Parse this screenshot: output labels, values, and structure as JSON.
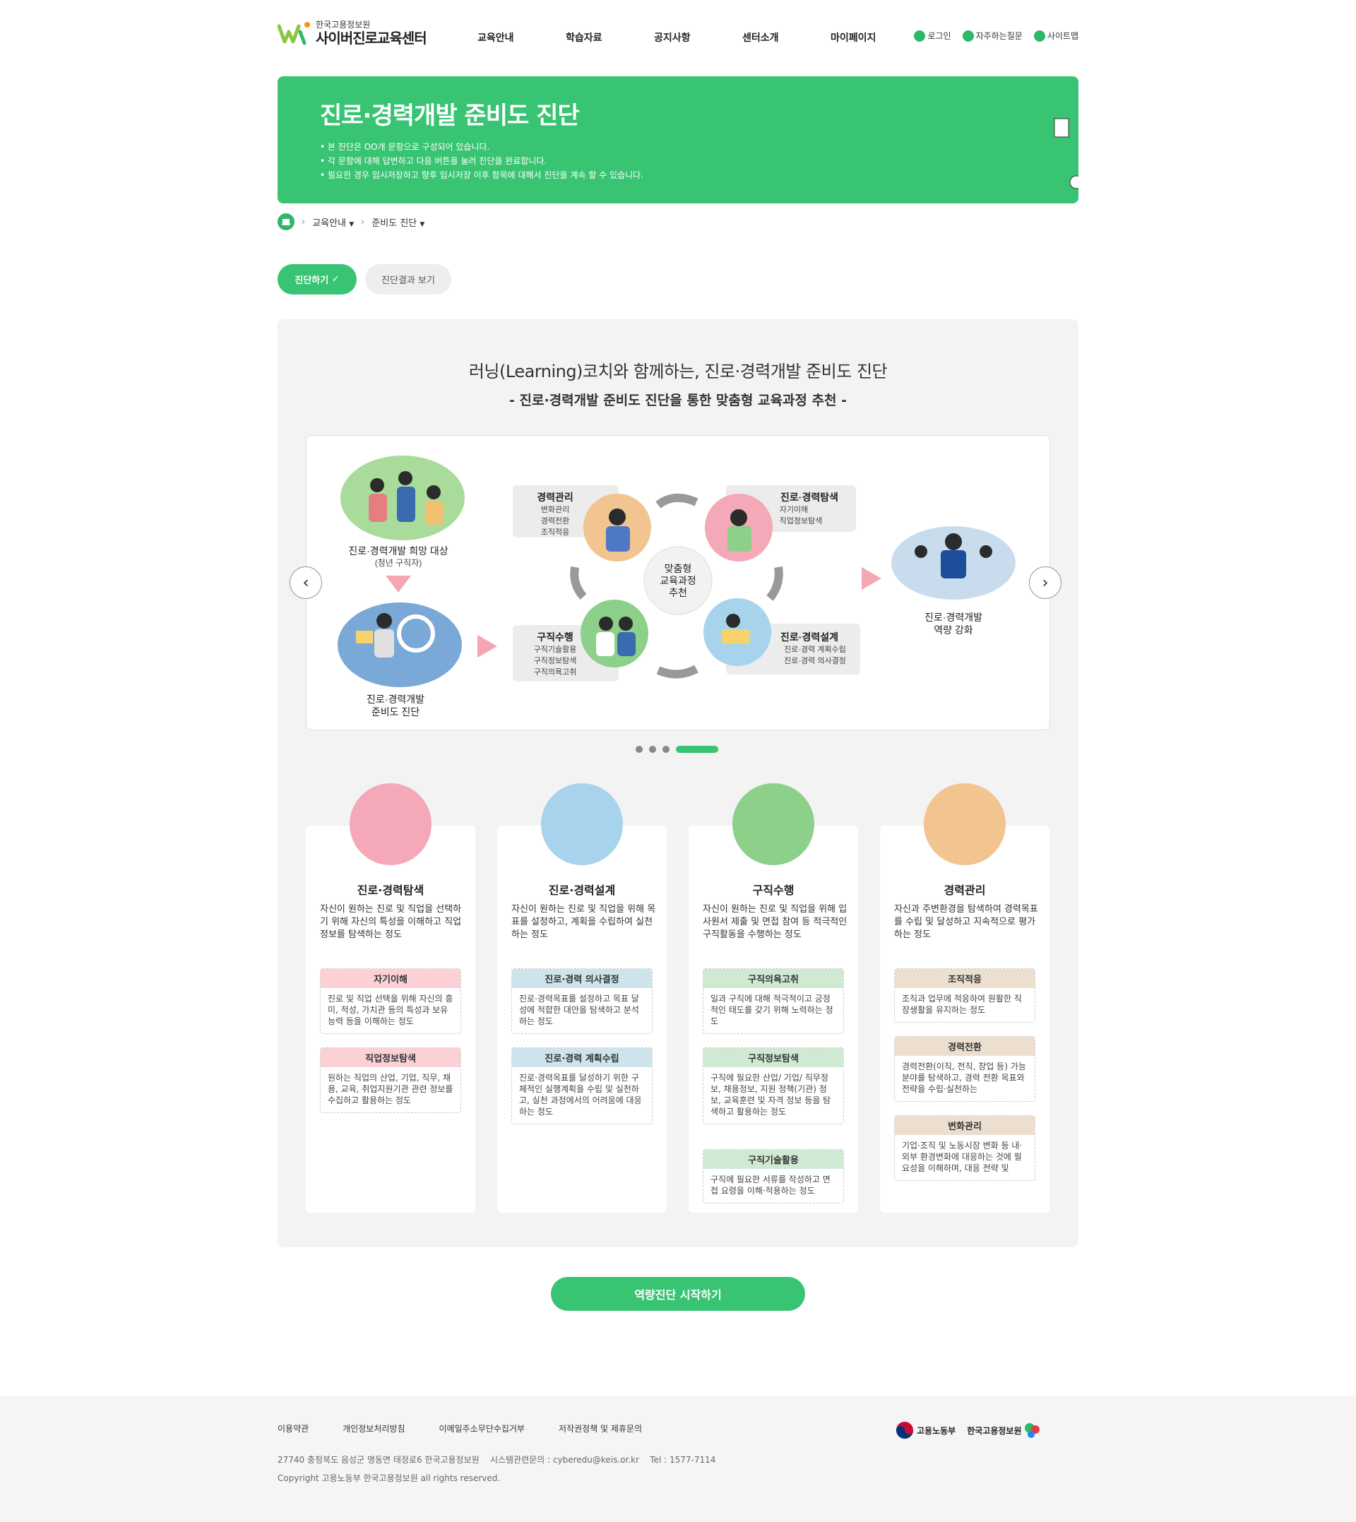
{
  "header": {
    "org": "한국고용정보원",
    "site_title": "사이버진로교육센터",
    "nav": [
      "교육안내",
      "학습자료",
      "공지사항",
      "센터소개",
      "마이페이지"
    ],
    "util": [
      "로그인",
      "자주하는질문",
      "사이트맵"
    ]
  },
  "banner": {
    "title": "진로·경력개발 준비도 진단",
    "bullets": [
      "• 본 진단은 OO개 문항으로 구성되어 있습니다.",
      "• 각 문항에 대해 답변하고 다음 버튼을 눌러 진단을 완료합니다.",
      "• 필요한 경우 임시저장하고 향후 임시저장 이후 항목에 대해서 진단을 계속 할 수 있습니다."
    ]
  },
  "breadcrumb": [
    "교육안내",
    "준비도 진단"
  ],
  "tabs": {
    "active": "진단하기",
    "inactive": "진단결과 보기"
  },
  "intro": {
    "title": "러닝(Learning)코치와 함께하는, 진로·경력개발 준비도 진단",
    "subtitle": "- 진로·경력개발 준비도 진단을 통한 맞춤형 교육과정 추천 -"
  },
  "slide": {
    "target_title": "진로·경력개발 희망 대상",
    "target_sub": "(청년 구직자)",
    "diag_title_1": "진로·경력개발",
    "diag_title_2": "준비도 진단",
    "center_1": "맞춤형",
    "center_2": "교육과정",
    "center_3": "추천",
    "box_career_mgmt": {
      "title": "경력관리",
      "items": [
        "변화관리",
        "경력전환",
        "조직적응"
      ]
    },
    "box_explore": {
      "title": "진로·경력탐색",
      "items": [
        "자기이해",
        "직업정보탐색"
      ]
    },
    "box_job": {
      "title": "구직수행",
      "items": [
        "구직기술활용",
        "구직정보탐색",
        "구직의욕고취"
      ]
    },
    "box_design": {
      "title": "진로·경력설계",
      "items": [
        "진로·경력 계획수립",
        "진로·경력 의사결정"
      ]
    },
    "result_1": "진로·경력개발",
    "result_2": "역량 강화",
    "prev": "‹",
    "next": "›"
  },
  "cards": [
    {
      "title": "진로·경력탐색",
      "desc": "자신이 원하는 진로 및 직업을 선택하기 위해 자신의 특성을 이해하고 직업정보를 탐색하는 정도",
      "subs": [
        {
          "title": "자기이해",
          "body": "진로 및 직업 선택을 위해 자신의 흥미, 적성, 가치관 등의 특성과 보유 능력 등을 이해하는 정도"
        },
        {
          "title": "직업정보탐색",
          "body": "원하는 직업의 산업, 기업, 직무, 채용, 교육, 취업지원기관 관련 정보를 수집하고 활용하는 정도"
        }
      ]
    },
    {
      "title": "진로·경력설계",
      "desc": "자신이 원하는 진로 및 직업을 위해 목표를 설정하고, 계획을 수립하여 실천하는 정도",
      "subs": [
        {
          "title": "진로·경력 의사결정",
          "body": "진로·경력목표를 설정하고 목표 달성에 적합한 대안을 탐색하고 분석하는 정도"
        },
        {
          "title": "진로·경력 계획수립",
          "body": "진로·경력목표를 달성하기 위한 구체적인 실행계획을 수립 및 실천하고, 실천 과정에서의 어려움에 대응하는 정도"
        }
      ]
    },
    {
      "title": "구직수행",
      "desc": "자신이 원하는 진로 및 직업을 위해 입사원서 제출 및 면접 참여 등 적극적인 구직활동을 수행하는 정도",
      "subs": [
        {
          "title": "구직의욕고취",
          "body": "일과 구직에 대해 적극적이고 긍정적인 태도를 갖기 위해 노력하는 정도"
        },
        {
          "title": "구직정보탐색",
          "body": "구직에 필요한 산업/ 기업/ 직무정보, 채용정보, 지원 정책(기관) 정보, 교육훈련 및 자격 정보 등을 탐색하고 활용하는 정도"
        },
        {
          "title": "구직기술활용",
          "body": "구직에 필요한 서류를 작성하고 면접 요령을 이해·적용하는 정도"
        }
      ]
    },
    {
      "title": "경력관리",
      "desc": "자신과 주변환경을 탐색하여 경력목표를 수립 및 달성하고 지속적으로 평가하는 정도",
      "subs": [
        {
          "title": "조직적응",
          "body": "조직과 업무에 적응하여 원활한 직장생활을 유지하는 정도"
        },
        {
          "title": "경력전환",
          "body": "경력전환(이직, 전직, 창업 등) 가능 분야를 탐색하고, 경력 전환 목표와 전략을 수립·실천하는"
        },
        {
          "title": "변화관리",
          "body": "기업·조직 및 노동시장 변화 등 내·외부 환경변화에 대응하는 것에 필요성을 이해하며, 대응 전략 및"
        }
      ]
    }
  ],
  "start_button": "역량진단 시작하기",
  "footer": {
    "links": [
      "이용약관",
      "개인정보처리방침",
      "이메일주소무단수집거부",
      "저작권정책 및 제휴문의"
    ],
    "address": "27740 충청북도 음성군 맹동면 태정로6 한국고용정보원    시스템관련문의 : cyberedu@keis.or.kr    Tel : 1577-7114",
    "copyright": "Copyright 고용노동부 한국고용정보원 all rights reserved.",
    "logo1": "고용노동부",
    "logo2": "한국고용정보원"
  }
}
